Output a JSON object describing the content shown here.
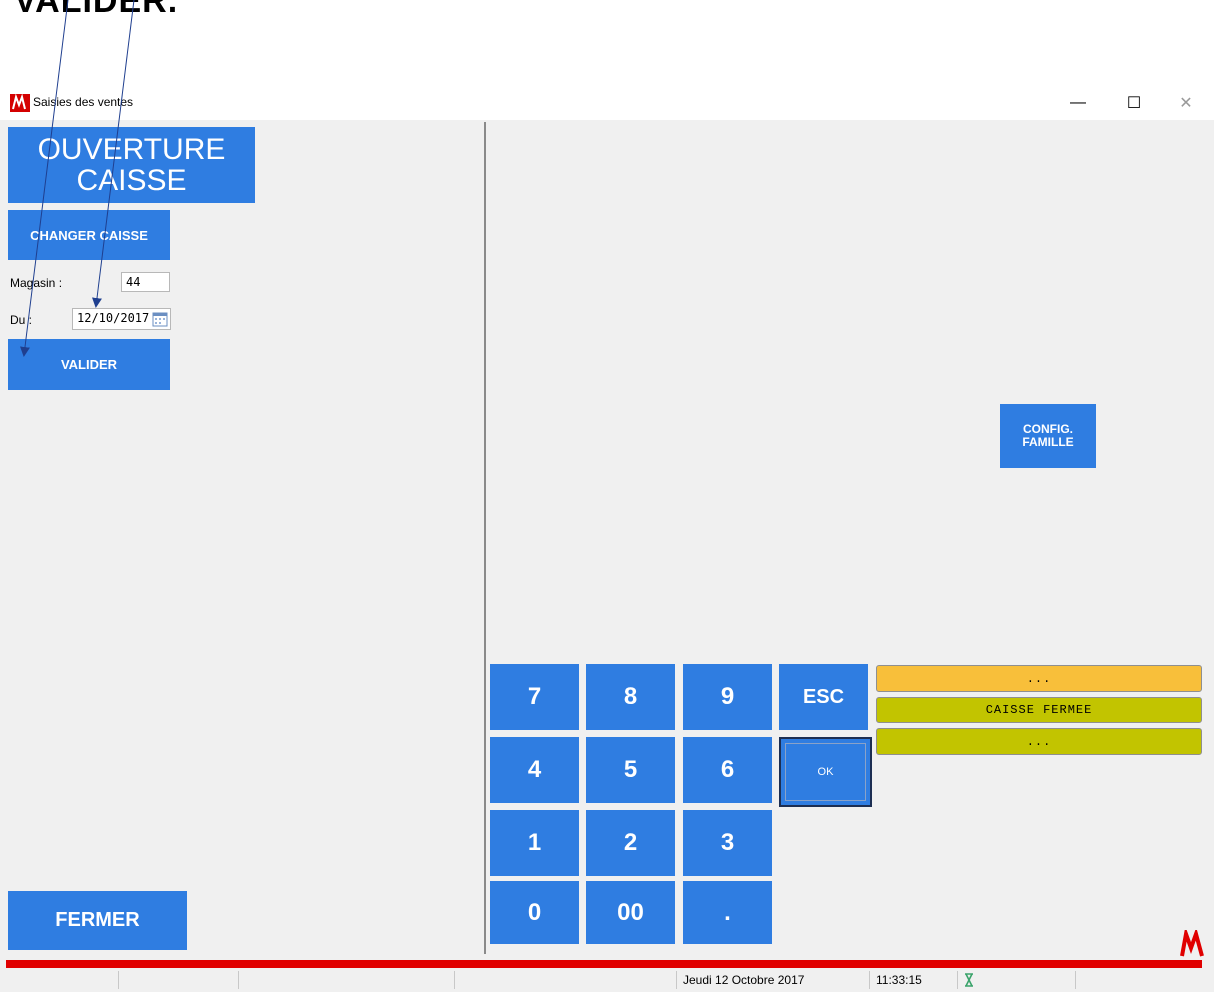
{
  "annotation": {
    "title": "VALIDER."
  },
  "window": {
    "title": "Saisies des ventes",
    "controls": {
      "minimize": "—",
      "maximize": "☐",
      "close": "✕"
    }
  },
  "left_panel": {
    "open_button": "OUVERTURE CAISSE",
    "change_button": "CHANGER CAISSE",
    "store_label": "Magasin :",
    "store_value": "44",
    "date_label": "Du :",
    "date_value": "12/10/2017",
    "validate_button": "VALIDER",
    "close_button": "FERMER"
  },
  "right_panel": {
    "config_button": "CONFIG. FAMILLE",
    "keypad": [
      "7",
      "8",
      "9",
      "ESC",
      "4",
      "5",
      "6",
      "OK",
      "1",
      "2",
      "3",
      "0",
      "00",
      "."
    ],
    "status_lines": [
      "...",
      "CAISSE FERMEE",
      "..."
    ]
  },
  "colors": {
    "accent_blue": "#2f7de1",
    "status_orange": "#f8bf3a",
    "status_olive": "#c2c400",
    "bar_red": "#e00000"
  },
  "statusbar": {
    "date": "Jeudi 12 Octobre 2017",
    "time": "11:33:15"
  }
}
